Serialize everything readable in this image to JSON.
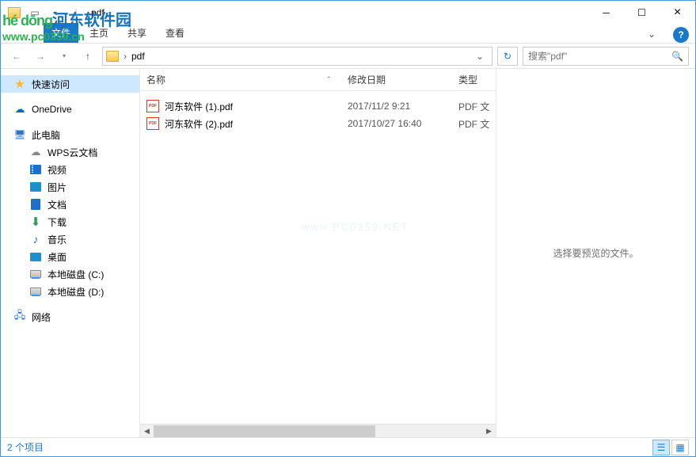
{
  "window": {
    "title": "pdf"
  },
  "ribbon": {
    "tabs": [
      "文件",
      "主页",
      "共享",
      "查看"
    ]
  },
  "addressbar": {
    "path": "pdf",
    "search_placeholder": "搜索\"pdf\""
  },
  "navpane": {
    "quick": "快速访问",
    "onedrive": "OneDrive",
    "thispc": "此电脑",
    "wps": "WPS云文档",
    "video": "视频",
    "pictures": "图片",
    "documents": "文档",
    "downloads": "下载",
    "music": "音乐",
    "desktop": "桌面",
    "disk_c": "本地磁盘 (C:)",
    "disk_d": "本地磁盘 (D:)",
    "network": "网络"
  },
  "columns": {
    "name": "名称",
    "date": "修改日期",
    "type": "类型"
  },
  "files": [
    {
      "name": "河东软件 (1).pdf",
      "date": "2017/11/2 9:21",
      "type": "PDF 文"
    },
    {
      "name": "河东软件 (2).pdf",
      "date": "2017/10/27 16:40",
      "type": "PDF 文"
    }
  ],
  "preview": {
    "empty": "选择要预览的文件。"
  },
  "status": {
    "count": "2 个项目"
  },
  "watermark": {
    "pinyin": "hé dōng",
    "hanzi": "河东软件园",
    "url": "www.pc0359.cn",
    "center": "www.PC0359.NET"
  }
}
